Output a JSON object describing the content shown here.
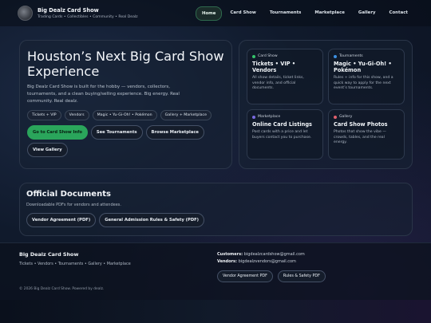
{
  "header": {
    "title": "Big Dealz Card Show",
    "tagline": "Trading Cards • Collectibles • Community • Real Dealz",
    "nav": [
      "Home",
      "Card Show",
      "Tournaments",
      "Marketplace",
      "Gallery",
      "Contact"
    ],
    "active": "Home"
  },
  "hero": {
    "title": "Houston’s Next Big Card Show Experience",
    "description": "Big Dealz Card Show is built for the hobby — vendors, collectors, tournaments, and a clean buying/selling experience. Big energy. Real community. Real dealz.",
    "pills": [
      "Tickets + VIP",
      "Vendors",
      "Magic • Yu-Gi-Oh! • Pokémon",
      "Gallery + Marketplace"
    ],
    "buttons": [
      "Go to Card Show Info",
      "See Tournaments",
      "Browse Marketplace",
      "View Gallery"
    ]
  },
  "cards": [
    {
      "tag": "Card Show",
      "color": "#35c46a",
      "title": "Tickets • VIP • Vendors",
      "desc": "All show details, ticket links, vendor info, and official documents."
    },
    {
      "tag": "Tournaments",
      "color": "#3b8fe0",
      "title": "Magic • Yu-Gi-Oh! • Pokémon",
      "desc": "Rules + info for this show, and a quick way to apply for the next event’s tournaments."
    },
    {
      "tag": "Marketplace",
      "color": "#7a6ae0",
      "title": "Online Card Listings",
      "desc": "Post cards with a price and let buyers contact you to purchase."
    },
    {
      "tag": "Gallery",
      "color": "#e0606c",
      "title": "Card Show Photos",
      "desc": "Photos that show the vibe — crowds, tables, and the real energy."
    }
  ],
  "documents": {
    "title": "Official Documents",
    "subtitle": "Downloadable PDFs for vendors and attendees.",
    "buttons": [
      "Vendor Agreement (PDF)",
      "General Admission Rules & Safety (PDF)"
    ]
  },
  "footer": {
    "title": "Big Dealz Card Show",
    "links": "Tickets • Vendors • Tournaments • Gallery • Marketplace",
    "copyright": "© 2026 Big Dealz Card Show. Powered by dealz.",
    "customers_label": "Customers:",
    "customers_email": "bigdealzcardshow@gmail.com",
    "vendors_label": "Vendors:",
    "vendors_email": "bigdealzvendors@gmail.com",
    "buttons": [
      "Vendor Agreement PDF",
      "Rules & Safety PDF"
    ]
  }
}
